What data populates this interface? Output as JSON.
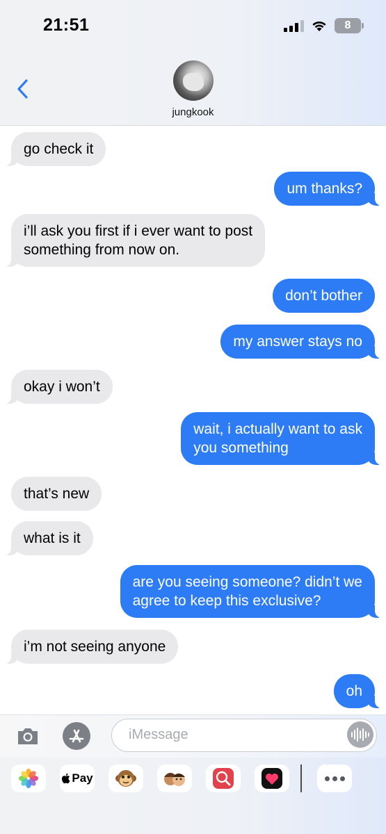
{
  "status_bar": {
    "time": "21:51",
    "battery": "8"
  },
  "header": {
    "contact_name": "jungkook"
  },
  "messages": [
    {
      "side": "received",
      "text": "go check it"
    },
    {
      "side": "sent",
      "text": "um thanks?"
    },
    {
      "side": "received",
      "text": "i’ll ask you first if i ever want to post\nsomething from now on."
    },
    {
      "side": "sent",
      "text": "don’t bother"
    },
    {
      "side": "sent",
      "text": "my answer stays no"
    },
    {
      "side": "received",
      "text": "okay i won’t"
    },
    {
      "side": "sent",
      "text": "wait, i actually want to ask\nyou something"
    },
    {
      "side": "received",
      "text": "that’s new"
    },
    {
      "side": "received",
      "text": "what is it"
    },
    {
      "side": "sent",
      "text": "are you seeing someone? didn’t we\nagree to keep this exclusive?"
    },
    {
      "side": "received",
      "text": "i’m not seeing anyone"
    },
    {
      "side": "sent",
      "text": "oh"
    }
  ],
  "input": {
    "placeholder": "iMessage"
  },
  "app_drawer": {
    "apple_pay_label": "Pay",
    "apps": [
      "photos-icon",
      "apple-pay-icon",
      "monkey-memoji-icon",
      "memoji-stickers-icon",
      "web-search-icon",
      "digital-touch-icon",
      "more-icon"
    ]
  },
  "colors": {
    "sent_bubble": "#2d7cf6",
    "received_bubble": "#e9e9eb",
    "accent": "#2d7cf6"
  }
}
